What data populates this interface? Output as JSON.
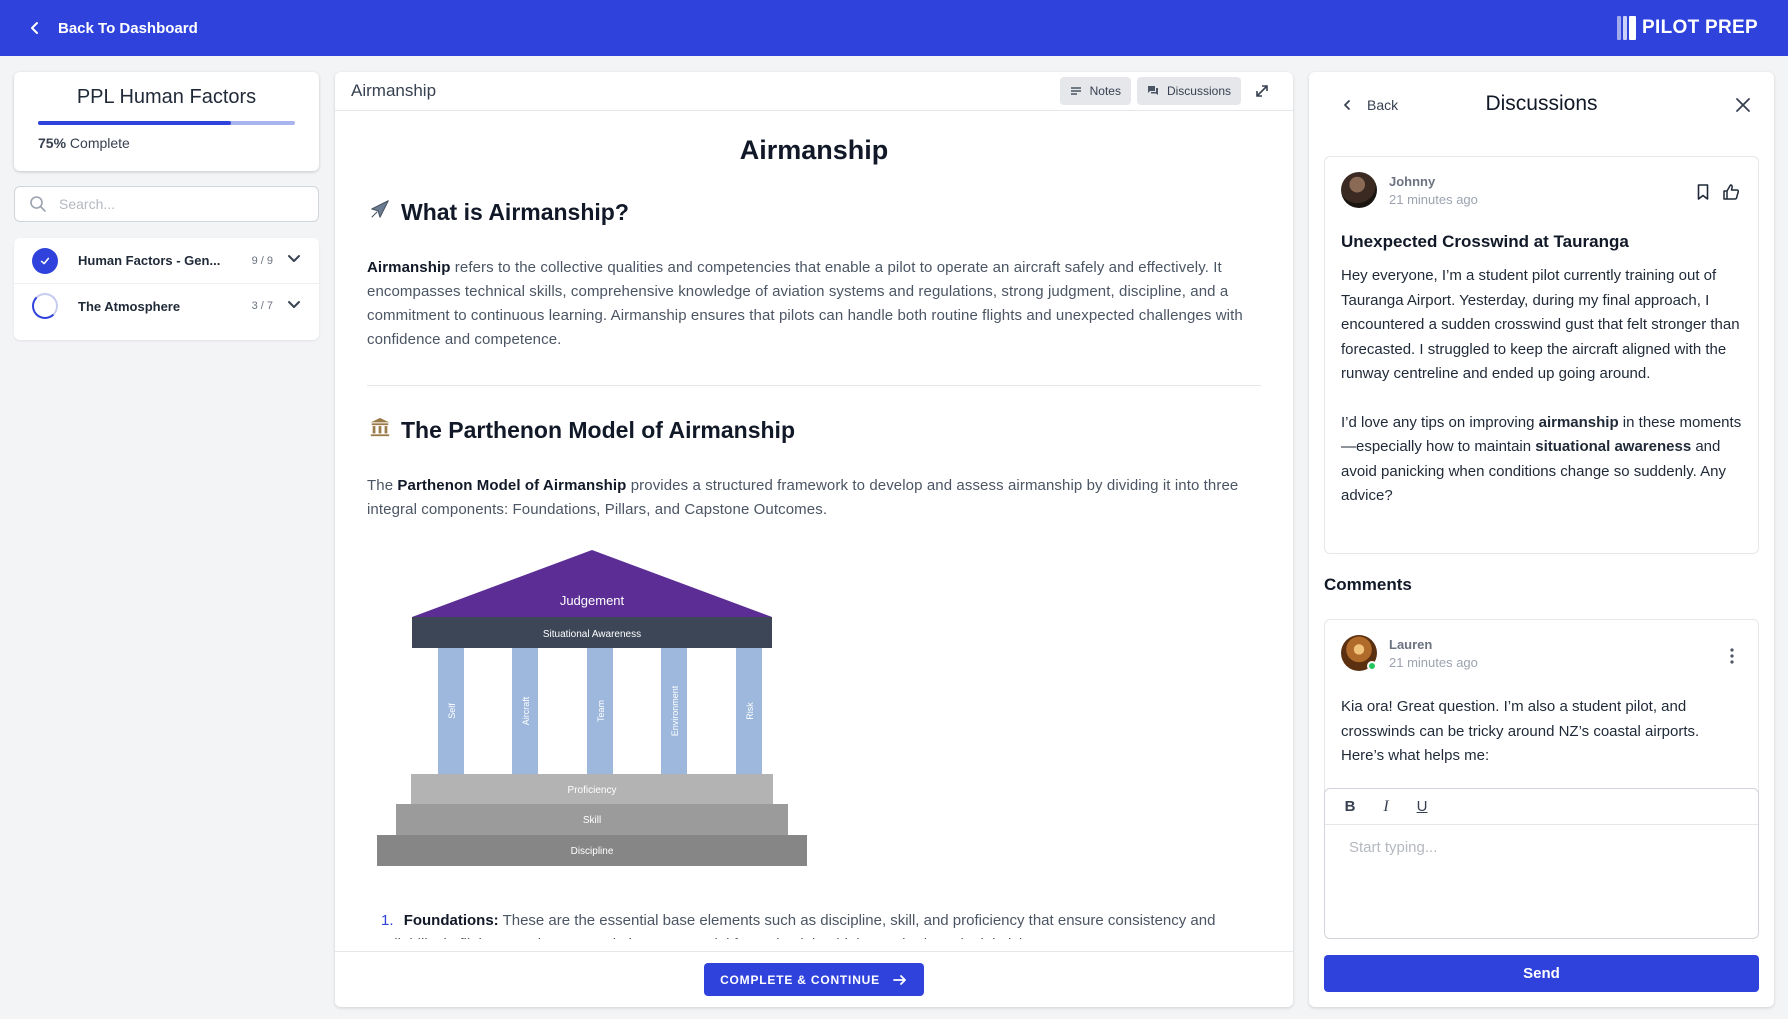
{
  "topbar": {
    "back_label": "Back To Dashboard",
    "logo_text": "PILOT PREP",
    "bg_color": "#2f43dc"
  },
  "sidebar": {
    "course_title": "PPL Human Factors",
    "progress_percent": 75,
    "progress_value": "75%",
    "progress_suffix": " Complete",
    "search_placeholder": "Search...",
    "modules": [
      {
        "title": "Human Factors - Gen...",
        "count": "9 / 9",
        "status": "complete"
      },
      {
        "title": "The Atmosphere",
        "count": "3 / 7",
        "status": "in-progress"
      }
    ]
  },
  "main": {
    "header_title": "Airmanship",
    "notes_label": "Notes",
    "discussions_label": "Discussions",
    "doc_title": "Airmanship",
    "section1_icon": "airplane-icon",
    "section1_title": "What is Airmanship?",
    "section1_bold": "Airmanship",
    "section1_text": " refers to the collective qualities and competencies that enable a pilot to operate an aircraft safely and effectively. It encompasses technical skills, comprehensive knowledge of aviation systems and regulations, strong judgment, discipline, and a commitment to continuous learning. Airmanship ensures that pilots can handle both routine flights and unexpected challenges with confidence and competence.",
    "section2_icon": "classical-building-icon",
    "section2_title": "The Parthenon Model of Airmanship",
    "section2_pre": "The ",
    "section2_bold": "Parthenon Model of Airmanship",
    "section2_text": " provides a structured framework to develop and assess airmanship by dividing it into three integral components: Foundations, Pillars, and Capstone Outcomes.",
    "diagram": {
      "roof": "Judgement",
      "beam": "Situational Awareness",
      "pillars": [
        "Self",
        "Aircraft",
        "Team",
        "Environment",
        "Risk"
      ],
      "steps": [
        "Proficiency",
        "Skill",
        "Discipline"
      ]
    },
    "list_item_num": "1.",
    "list_item_bold": "Foundations:",
    "list_item_text": " These are the essential base elements such as discipline, skill, and proficiency that ensure consistency and reliability in flight operations. Foundations are crucial for maintaining high standards and minimising errors.",
    "complete_label": "COMPLETE & CONTINUE"
  },
  "discussion": {
    "back_label": "Back",
    "title": "Discussions",
    "post": {
      "author": "Johnny",
      "time": "21 minutes ago",
      "title": "Unexpected Crosswind at Tauranga",
      "para1": "Hey everyone, I’m a student pilot currently training out of Tauranga Airport. Yesterday, during my final approach, I encountered a sudden crosswind gust that felt stronger than forecasted. I struggled to keep the aircraft aligned with the runway centreline and ended up going around.",
      "para2_pre": "I’d love any tips on improving ",
      "para2_bold1": "airmanship",
      "para2_mid": " in these moments—especially how to maintain ",
      "para2_bold2": "situational awareness",
      "para2_post": " and avoid panicking when conditions change so suddenly. Any advice?"
    },
    "comments_label": "Comments",
    "comment": {
      "author": "Lauren",
      "time": "21 minutes ago",
      "text": "Kia ora! Great question. I’m also a student pilot, and crosswinds can be tricky around NZ’s coastal airports. Here’s what helps me:"
    },
    "editor": {
      "bold": "B",
      "italic": "I",
      "underline": "U",
      "placeholder": "Start typing..."
    },
    "send_label": "Send"
  }
}
